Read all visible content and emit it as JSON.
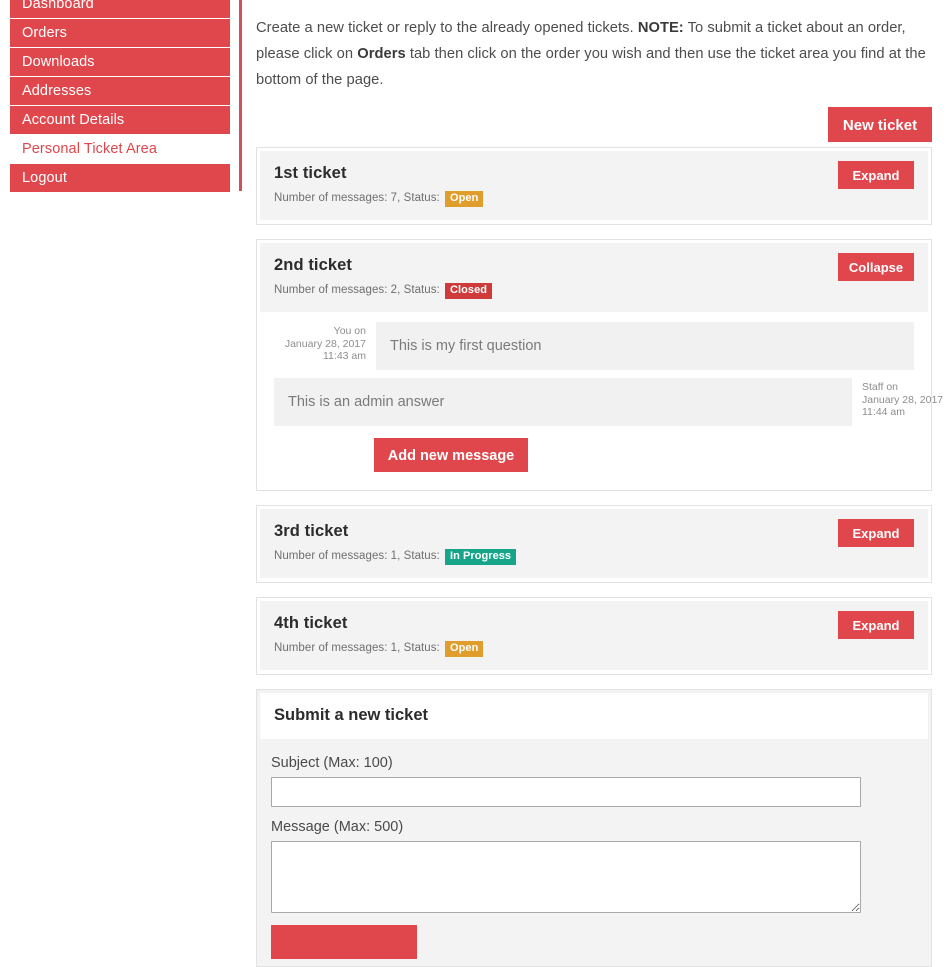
{
  "sidebar": {
    "items": [
      {
        "label": "Dashboard",
        "style": "filled"
      },
      {
        "label": "Orders",
        "style": "filled"
      },
      {
        "label": "Downloads",
        "style": "filled"
      },
      {
        "label": "Addresses",
        "style": "filled"
      },
      {
        "label": "Account Details",
        "style": "filled"
      },
      {
        "label": "Personal Ticket Area",
        "style": "plain"
      },
      {
        "label": "Logout",
        "style": "filled"
      }
    ]
  },
  "intro": {
    "line1_a": "Create a new ticket or reply to the already opened tickets. ",
    "line1_note": "NOTE:",
    "line1_b": " To submit a ticket about an order, please click on ",
    "line2_bold": "Orders",
    "line2_rest": " tab then click on the order you wish and then use the ticket area you find at the bottom of the page."
  },
  "actions": {
    "new_ticket": "New ticket",
    "expand": "Expand",
    "collapse": "Collapse",
    "add_new_message": "Add new message"
  },
  "tickets": [
    {
      "title": "1st ticket",
      "meta_prefix": "Number of messages: 7, Status:",
      "status": "Open",
      "status_kind": "open",
      "toggle": "Expand",
      "expanded": false
    },
    {
      "title": "2nd ticket",
      "meta_prefix": "Number of messages: 2, Status:",
      "status": "Closed",
      "status_kind": "closed",
      "toggle": "Collapse",
      "expanded": true,
      "messages": [
        {
          "author": "You on",
          "date": "January 28, 2017",
          "time": "11:43 am",
          "text": "This is my first question",
          "side": "user"
        },
        {
          "author": "Staff on",
          "date": "January 28, 2017",
          "time": "11:44 am",
          "text": "This is an admin answer",
          "side": "staff"
        }
      ]
    },
    {
      "title": "3rd ticket",
      "meta_prefix": "Number of messages: 1, Status:",
      "status": "In Progress",
      "status_kind": "progress",
      "toggle": "Expand",
      "expanded": false
    },
    {
      "title": "4th ticket",
      "meta_prefix": "Number of messages: 1, Status:",
      "status": "Open",
      "status_kind": "open",
      "toggle": "Expand",
      "expanded": false
    }
  ],
  "form": {
    "heading": "Submit a new ticket",
    "subject_label": "Subject (Max: 100)",
    "subject_value": "",
    "message_label": "Message (Max: 500)",
    "message_value": "",
    "submit_label": ""
  },
  "colors": {
    "brand_red": "#e0474c",
    "badge_open": "#e09d2b",
    "badge_closed": "#cf3b3b",
    "badge_progress": "#17a589",
    "card_head_bg": "#f3f3f3",
    "bubble_bg": "#f1f1f1"
  }
}
